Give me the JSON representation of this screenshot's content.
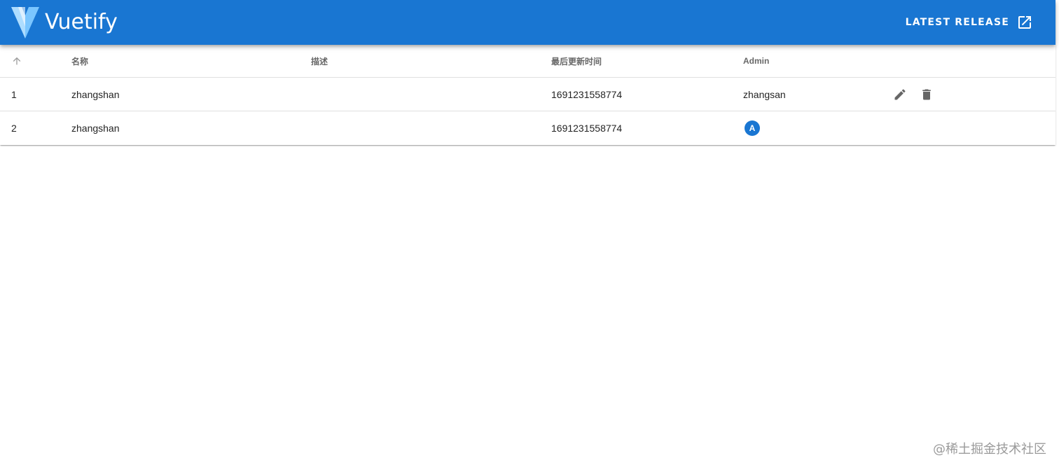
{
  "app_bar": {
    "brand": "Vuetify",
    "release_label": "LATEST RELEASE",
    "logo_icon": "vuetify-logo-icon",
    "release_icon": "open-in-new-icon",
    "color": "#1976d2"
  },
  "table": {
    "headers": {
      "sort_icon": "arrow-up-icon",
      "name": "名称",
      "desc": "描述",
      "time": "最后更新时间",
      "admin": "Admin"
    },
    "rows": [
      {
        "id": "1",
        "name": "zhangshan",
        "desc": "",
        "time": "1691231558774",
        "admin": "zhangsan"
      },
      {
        "id": "2",
        "name": "zhangshan",
        "desc": "",
        "time": "1691231558774",
        "admin_avatar": "A"
      }
    ],
    "action_icons": [
      "pencil-icon",
      "delete-icon"
    ]
  },
  "watermark": "@稀土掘金技术社区"
}
